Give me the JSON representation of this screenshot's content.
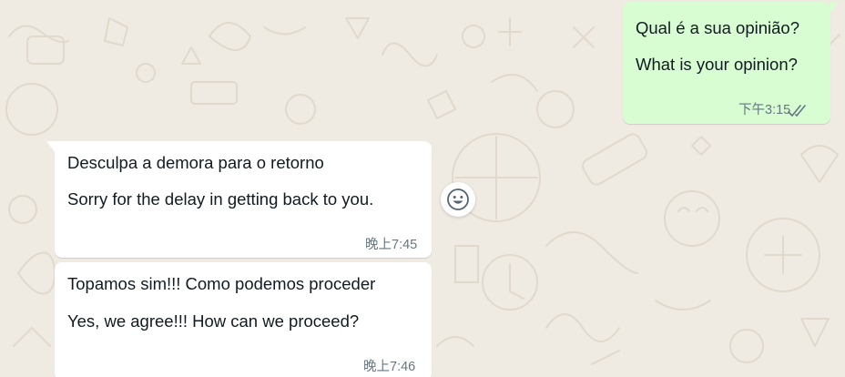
{
  "colors": {
    "background": "#efeae2",
    "outgoing_bubble": "#d9fdd3",
    "incoming_bubble": "#ffffff",
    "meta_text": "#667781",
    "read_ticks": "#667781"
  },
  "messages": [
    {
      "direction": "outgoing",
      "lines": [
        "Qual é a sua opinião?",
        "What is your opinion?"
      ],
      "time": "下午3:15",
      "status_icon": "double-check-icon"
    },
    {
      "direction": "incoming",
      "lines": [
        "Desculpa a demora para o retorno",
        "Sorry for the delay in getting back to you."
      ],
      "time": "晚上7:45"
    },
    {
      "direction": "incoming",
      "lines": [
        "Topamos sim!!! Como podemos proceder",
        "Yes, we agree!!! How can we proceed?"
      ],
      "time": "晚上7:46"
    }
  ],
  "reaction_button_icon": "smiley-icon"
}
